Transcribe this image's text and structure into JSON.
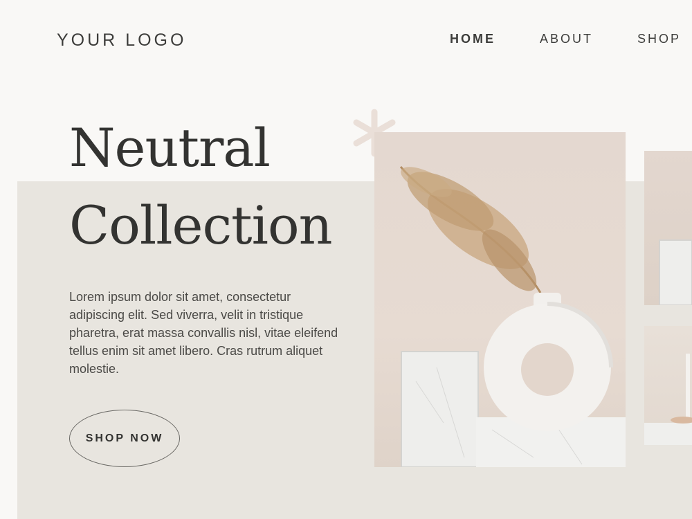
{
  "header": {
    "logo": "YOUR LOGO",
    "nav": [
      {
        "label": "HOME",
        "active": true
      },
      {
        "label": "ABOUT",
        "active": false
      },
      {
        "label": "SHOP",
        "active": false
      }
    ]
  },
  "hero": {
    "title_line1": "Neutral",
    "title_line2": "Collection",
    "description": "Lorem ipsum dolor sit amet, consectetur adipiscing elit. Sed viverra, velit in tristique pharetra, erat massa convallis nisl, vitae eleifend tellus enim sit amet libero. Cras rutrum aliquet molestie.",
    "cta_label": "SHOP NOW"
  },
  "images": {
    "main": "dried-pampas-grass-in-white-donut-vase-photo",
    "thumb_top": "marble-block-photo",
    "thumb_bottom": "candle-holder-photo",
    "decoration": "asterisk-icon"
  },
  "colors": {
    "page_background": "#f9f8f6",
    "panel_background": "#e8e5df",
    "text": "#3a3a38",
    "asterisk": "#eadfd8"
  }
}
